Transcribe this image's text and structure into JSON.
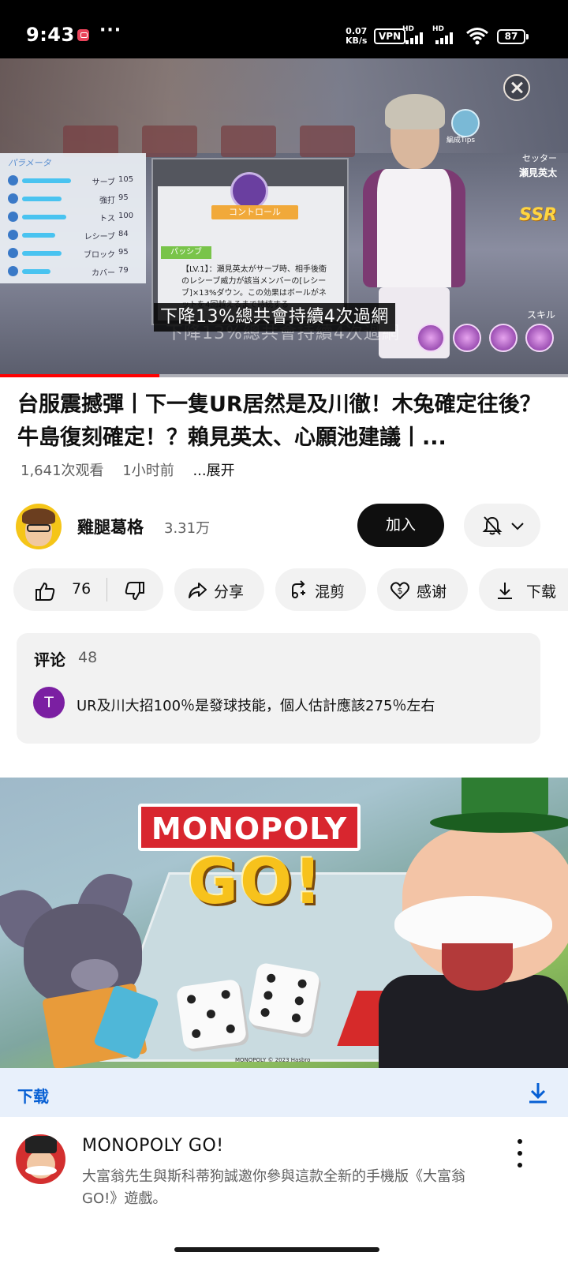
{
  "status_bar": {
    "time": "9:43",
    "more_glyph": "···",
    "net_speed_value": "0.07",
    "net_speed_unit": "KB/s",
    "vpn_label": "VPN",
    "hd_label": "HD",
    "battery_level": "87"
  },
  "video": {
    "subtitle": "下降13%總共會持續4次過網",
    "subtitle_ghost": "下降13%總共會持續4次過網",
    "progress_fraction": 0.28,
    "embedded": {
      "stats_title": "パラメータ",
      "stats": [
        {
          "name": "サーブ",
          "value": "105",
          "fill": 0.78
        },
        {
          "name": "強打",
          "value": "95",
          "fill": 0.62
        },
        {
          "name": "トス",
          "value": "100",
          "fill": 0.7
        },
        {
          "name": "レシーブ",
          "value": "84",
          "fill": 0.52
        },
        {
          "name": "ブロック",
          "value": "95",
          "fill": 0.62
        },
        {
          "name": "カバー",
          "value": "79",
          "fill": 0.45
        }
      ],
      "panel_ribbon": "コントロール",
      "panel_passive": "パッシブ",
      "panel_text": "【LV.1】：瀬見英太がサーブ時、相手後衛のレシーブ威力が該当メンバーの[レシーブ]×13%ダウン。この効果はボールがネットを4回越えるまで持続する",
      "position": "セッター",
      "character": "瀬見英太",
      "rarity": "SSR",
      "skill_label": "スキル",
      "tips_label": "編成Tips"
    }
  },
  "title": "台服震撼彈丨下一隻UR居然是及川徹！木兔確定往後？牛島復刻確定！？賴見英太、心願池建議丨...",
  "meta": {
    "views": "1,641次观看",
    "time_ago": "1小时前",
    "expand": "...展开"
  },
  "channel": {
    "name": "雞腿葛格",
    "subscribers": "3.31万",
    "join_label": "加入"
  },
  "actions": {
    "like_count": "76",
    "share_label": "分享",
    "remix_label": "混剪",
    "thanks_label": "感谢",
    "download_label": "下载"
  },
  "comments": {
    "header": "评论",
    "count": "48",
    "author_initial": "T",
    "top_comment": "UR及川大招100％是發球技能，個人估計應該275％左右"
  },
  "ad": {
    "logo_text": "MONOPOLY",
    "logo_go": "GO!",
    "copyright": "MONOPOLY © 2023 Hasbro",
    "download_label": "下载",
    "title": "MONOPOLY GO!",
    "description": "大富翁先生與斯科蒂狗誠邀你參與這款全新的手機版《大富翁GO!》遊戲。"
  }
}
